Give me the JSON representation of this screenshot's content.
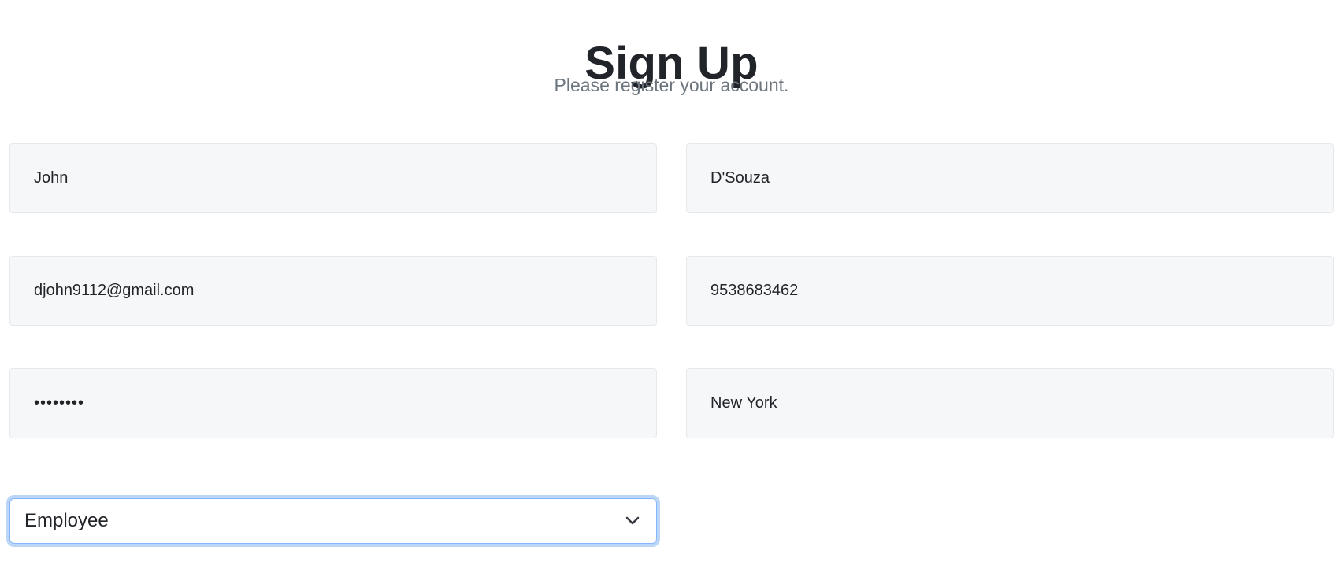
{
  "header": {
    "title": "Sign Up",
    "subtitle": "Please register your account."
  },
  "form": {
    "first_name": {
      "value": "John"
    },
    "last_name": {
      "value": "D'Souza"
    },
    "email": {
      "value": "djohn9112@gmail.com"
    },
    "phone": {
      "value": "9538683462"
    },
    "password": {
      "value": "••••••••"
    },
    "city": {
      "value": "New York"
    },
    "role": {
      "selected": "Employee",
      "icon": "chevron-down-icon"
    }
  },
  "colors": {
    "field_background": "#f6f7f9",
    "focus_ring": "#bcd6f7",
    "title_text": "#212529",
    "subtitle_text": "#6c757d"
  }
}
